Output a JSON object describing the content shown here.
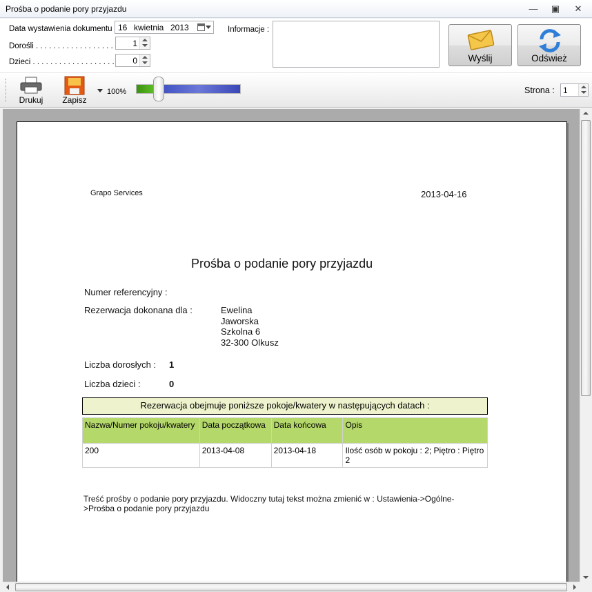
{
  "window": {
    "title": "Prośba o podanie pory przyjazdu"
  },
  "form": {
    "date_label": "Data wystawienia dokumentu .",
    "date_day": "16",
    "date_month": "kwietnia",
    "date_year": "2013",
    "adults_label": "Dorośli . . . . . . . . . . . . . . . . . .",
    "adults_value": "1",
    "children_label": "Dzieci . . . . . . . . . . . . . . . . . . .",
    "children_value": "0",
    "info_label": "Informacje :",
    "info_value": "",
    "send_label": "Wyślij",
    "refresh_label": "Odśwież"
  },
  "toolbar": {
    "print_label": "Drukuj",
    "save_label": "Zapisz",
    "zoom_label": "100%",
    "zoom_level_percent": 100,
    "page_label": "Strona :",
    "page_value": "1"
  },
  "document": {
    "company": "Grapo Services",
    "date": "2013-04-16",
    "title": "Prośba o podanie pory przyjazdu",
    "ref_label": "Numer referencyjny :",
    "reservation_label": "Rezerwacja dokonana dla :",
    "guest": {
      "first_name": "Ewelina",
      "last_name": "Jaworska",
      "street": "Szkolna 6",
      "city": "32-300 Olkusz"
    },
    "adults_label": "Liczba dorosłych :",
    "adults_value": "1",
    "children_label": "Liczba dzieci :",
    "children_value": "0",
    "rooms_header": "Rezerwacja obejmuje poniższe pokoje/kwatery w następujących datach :",
    "table": {
      "columns": [
        "Nazwa/Numer pokoju/kwatery",
        "Data początkowa",
        "Data końcowa",
        "Opis"
      ],
      "rows": [
        [
          "200",
          "2013-04-08",
          "2013-04-18",
          "Ilość osób w pokoju : 2; Piętro : Piętro 2"
        ]
      ]
    },
    "footer": "Treść prośby o podanie pory przyjazdu. Widoczny tutaj tekst można zmienić w : Ustawienia->Ogólne->Prośba o podanie pory przyjazdu"
  },
  "colors": {
    "table_header": "#b5d86b",
    "rooms_header_bg": "#eef3cd",
    "preview_bg": "#ababab"
  },
  "icons": {
    "minimize": "minimize-icon",
    "maximize": "maximize-icon",
    "close": "close-icon",
    "send": "envelope-icon",
    "refresh": "refresh-icon",
    "print": "printer-icon",
    "save": "save-icon"
  }
}
